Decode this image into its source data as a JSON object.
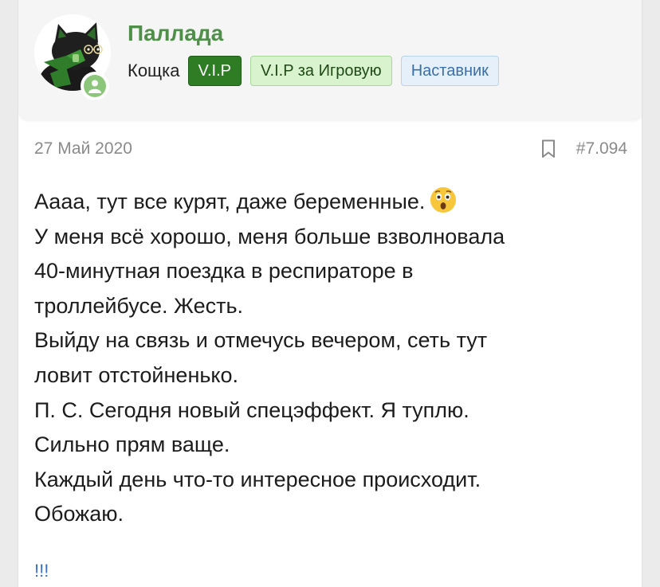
{
  "user": {
    "name": "Паллада",
    "title": "Кощка",
    "badges": [
      "V.I.P",
      "V.I.P за Игровую",
      "Наставник"
    ]
  },
  "post": {
    "date": "27 Май 2020",
    "number": "#7.094",
    "lines": [
      "Аааа, тут все курят, даже беременные.",
      "У меня всё хорошо, меня больше взволновала",
      "40-минутная поездка в респираторе в",
      "троллейбусе. Жесть.",
      "Выйду на связь и отмечусь вечером, сеть тут",
      "ловит отстойненько.",
      "П. С. Сегодня новый спецэффект. Я туплю.",
      "Сильно прям ваще.",
      "Каждый день что-то интересное происходит.",
      "Обожаю."
    ],
    "emoji": "astonished-face-icon",
    "signature": "!!!"
  },
  "colors": {
    "username": "#4f8f49",
    "vip_badge": "#2e7d24",
    "vip_game_badge": "#d9f3cf",
    "mentor_badge": "#e5f0fb",
    "online_dot": "#8cc67a",
    "meta_text": "#8a8a8a",
    "link": "#3a6fc4"
  }
}
